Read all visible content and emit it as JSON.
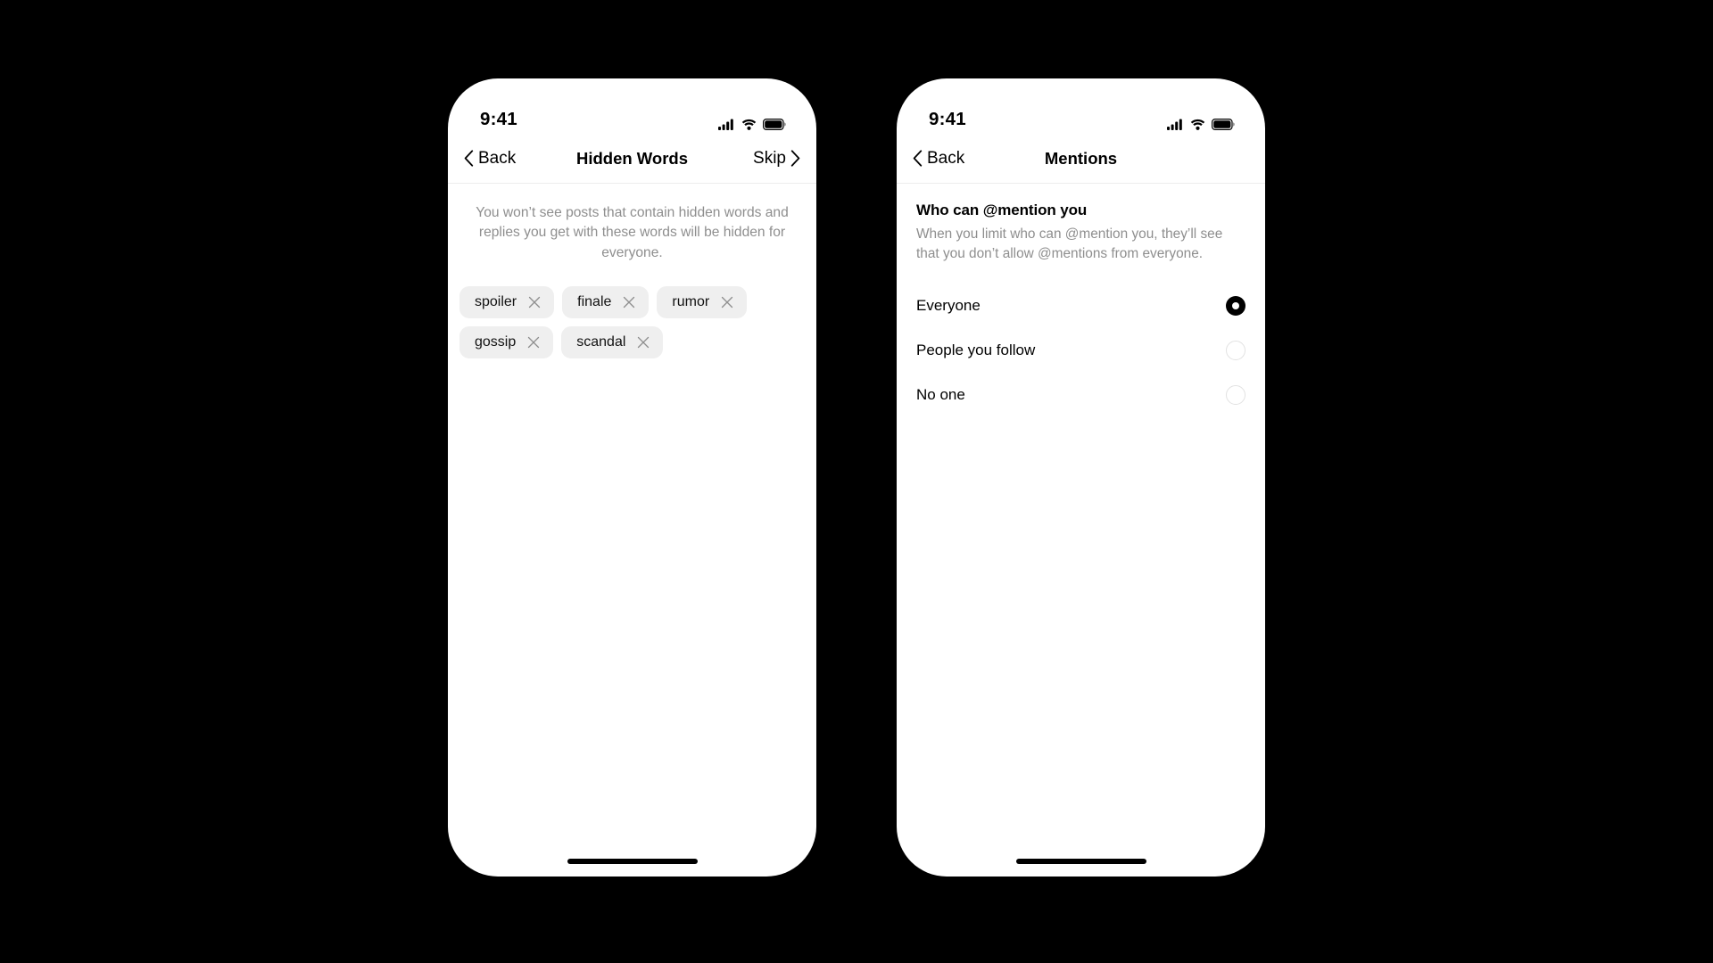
{
  "background_color": "#000000",
  "status_bar": {
    "time": "9:41",
    "icons": [
      "cellular-signal-icon",
      "wifi-icon",
      "battery-icon"
    ]
  },
  "phones": [
    {
      "name": "hidden-words",
      "nav": {
        "back_label": "Back",
        "back_icon": "chevron-left-icon",
        "title": "Hidden Words",
        "action_label": "Skip",
        "action_icon": "chevron-right-icon"
      },
      "description": "You won’t see posts that contain hidden words and replies you get with these words will be hidden for everyone.",
      "chips": [
        {
          "label": "spoiler",
          "remove_icon": "close-icon"
        },
        {
          "label": "finale",
          "remove_icon": "close-icon"
        },
        {
          "label": "rumor",
          "remove_icon": "close-icon"
        },
        {
          "label": "gossip",
          "remove_icon": "close-icon"
        },
        {
          "label": "scandal",
          "remove_icon": "close-icon"
        }
      ]
    },
    {
      "name": "mentions",
      "nav": {
        "back_label": "Back",
        "back_icon": "chevron-left-icon",
        "title": "Mentions"
      },
      "section_title": "Who can @mention you",
      "section_subtitle": "When you limit who can @mention you, they’ll see that you don’t allow @mentions from everyone.",
      "options": [
        {
          "label": "Everyone",
          "selected": true
        },
        {
          "label": "People you follow",
          "selected": false
        },
        {
          "label": "No one",
          "selected": false
        }
      ]
    }
  ],
  "colors": {
    "chip_background": "#efefef",
    "muted_text": "#8e8e8e",
    "primary_text": "#000000",
    "radio_selected": "#000000",
    "radio_unselected_border": "#e2e2e2",
    "divider": "#ededed"
  }
}
